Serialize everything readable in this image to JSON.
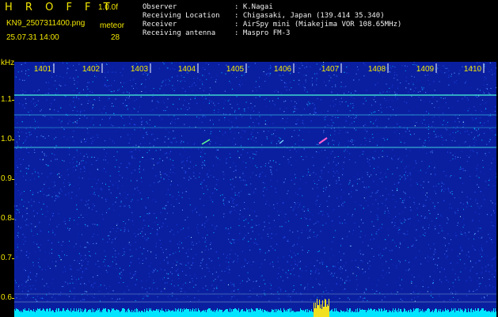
{
  "header": {
    "title": "H R O F F T",
    "version": "1.0.0f",
    "filename": "KN9_2507311400.png",
    "datetime": "25.07.31 14:00",
    "meteor_label": "meteor",
    "meteor_count": "28"
  },
  "info": {
    "rows": [
      {
        "label": "Observer",
        "value": ": K.Nagai"
      },
      {
        "label": "Receiving Location",
        "value": ": Chigasaki, Japan (139.414 35.340)"
      },
      {
        "label": "Receiver",
        "value": ": AirSpy mini (Miakejima VOR 108.65MHz)"
      },
      {
        "label": "Receiving antenna",
        "value": ": Maspro FM-3"
      }
    ]
  },
  "axis": {
    "y_unit": "kHz",
    "y_ticks": [
      "1.1",
      "1.0",
      "0.9",
      "0.8",
      "0.7",
      "0.6"
    ],
    "x_ticks": [
      "1401",
      "1402",
      "1403",
      "1404",
      "1405",
      "1406",
      "1407",
      "1408",
      "1409",
      "1410"
    ]
  },
  "colors": {
    "background": "#000000",
    "label": "#f2e600",
    "text": "#f0f0f0",
    "spectrogram_base": "#0a1fa0",
    "carrier_line": "#40e0d0",
    "noise_floor": "#00e5ff"
  }
}
